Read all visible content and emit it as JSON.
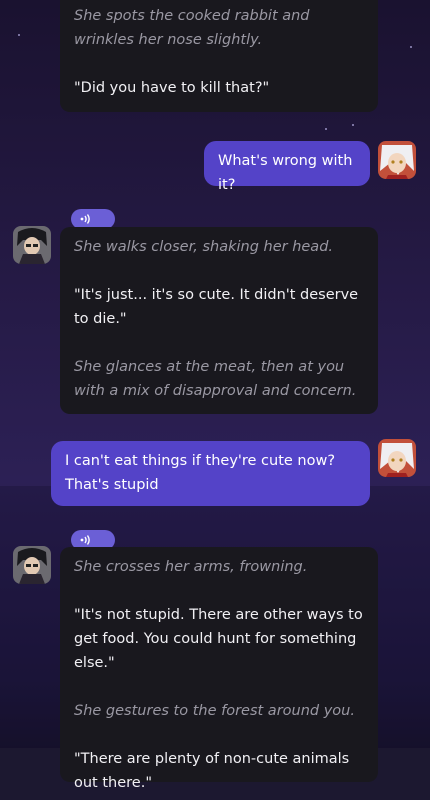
{
  "messages": [
    {
      "role": "bot",
      "parts": [
        {
          "kind": "action",
          "text": "She spots the cooked rabbit and wrinkles her nose slightly."
        },
        {
          "kind": "speech",
          "text": "\"Did you have to kill that?\""
        }
      ]
    },
    {
      "role": "user",
      "text": "What's wrong with it?"
    },
    {
      "role": "bot",
      "parts": [
        {
          "kind": "action",
          "text": "She walks closer, shaking her head."
        },
        {
          "kind": "speech",
          "text": "\"It's just... it's so cute. It didn't deserve to die.\""
        },
        {
          "kind": "action",
          "text": "She glances at the meat, then at you with a mix of disapproval and concern."
        }
      ]
    },
    {
      "role": "user",
      "text": "I can't eat things if they're cute now? That's stupid"
    },
    {
      "role": "bot",
      "parts": [
        {
          "kind": "action",
          "text": "She crosses her arms, frowning."
        },
        {
          "kind": "speech",
          "text": "\"It's not stupid. There are other ways to get food. You could hunt for something else.\""
        },
        {
          "kind": "action",
          "text": "She gestures to the forest around you."
        },
        {
          "kind": "speech",
          "text": "\"There are plenty of non-cute animals out there.\""
        }
      ]
    }
  ],
  "icons": {
    "audio": "speaker-wave-icon",
    "user_avatar": "user-avatar",
    "character_avatar": "character-avatar"
  },
  "colors": {
    "user_bubble": "#5443c8",
    "bot_bubble": "#19181e",
    "audio_pill": "#6b5fd6",
    "action_text": "#9a98a3"
  }
}
